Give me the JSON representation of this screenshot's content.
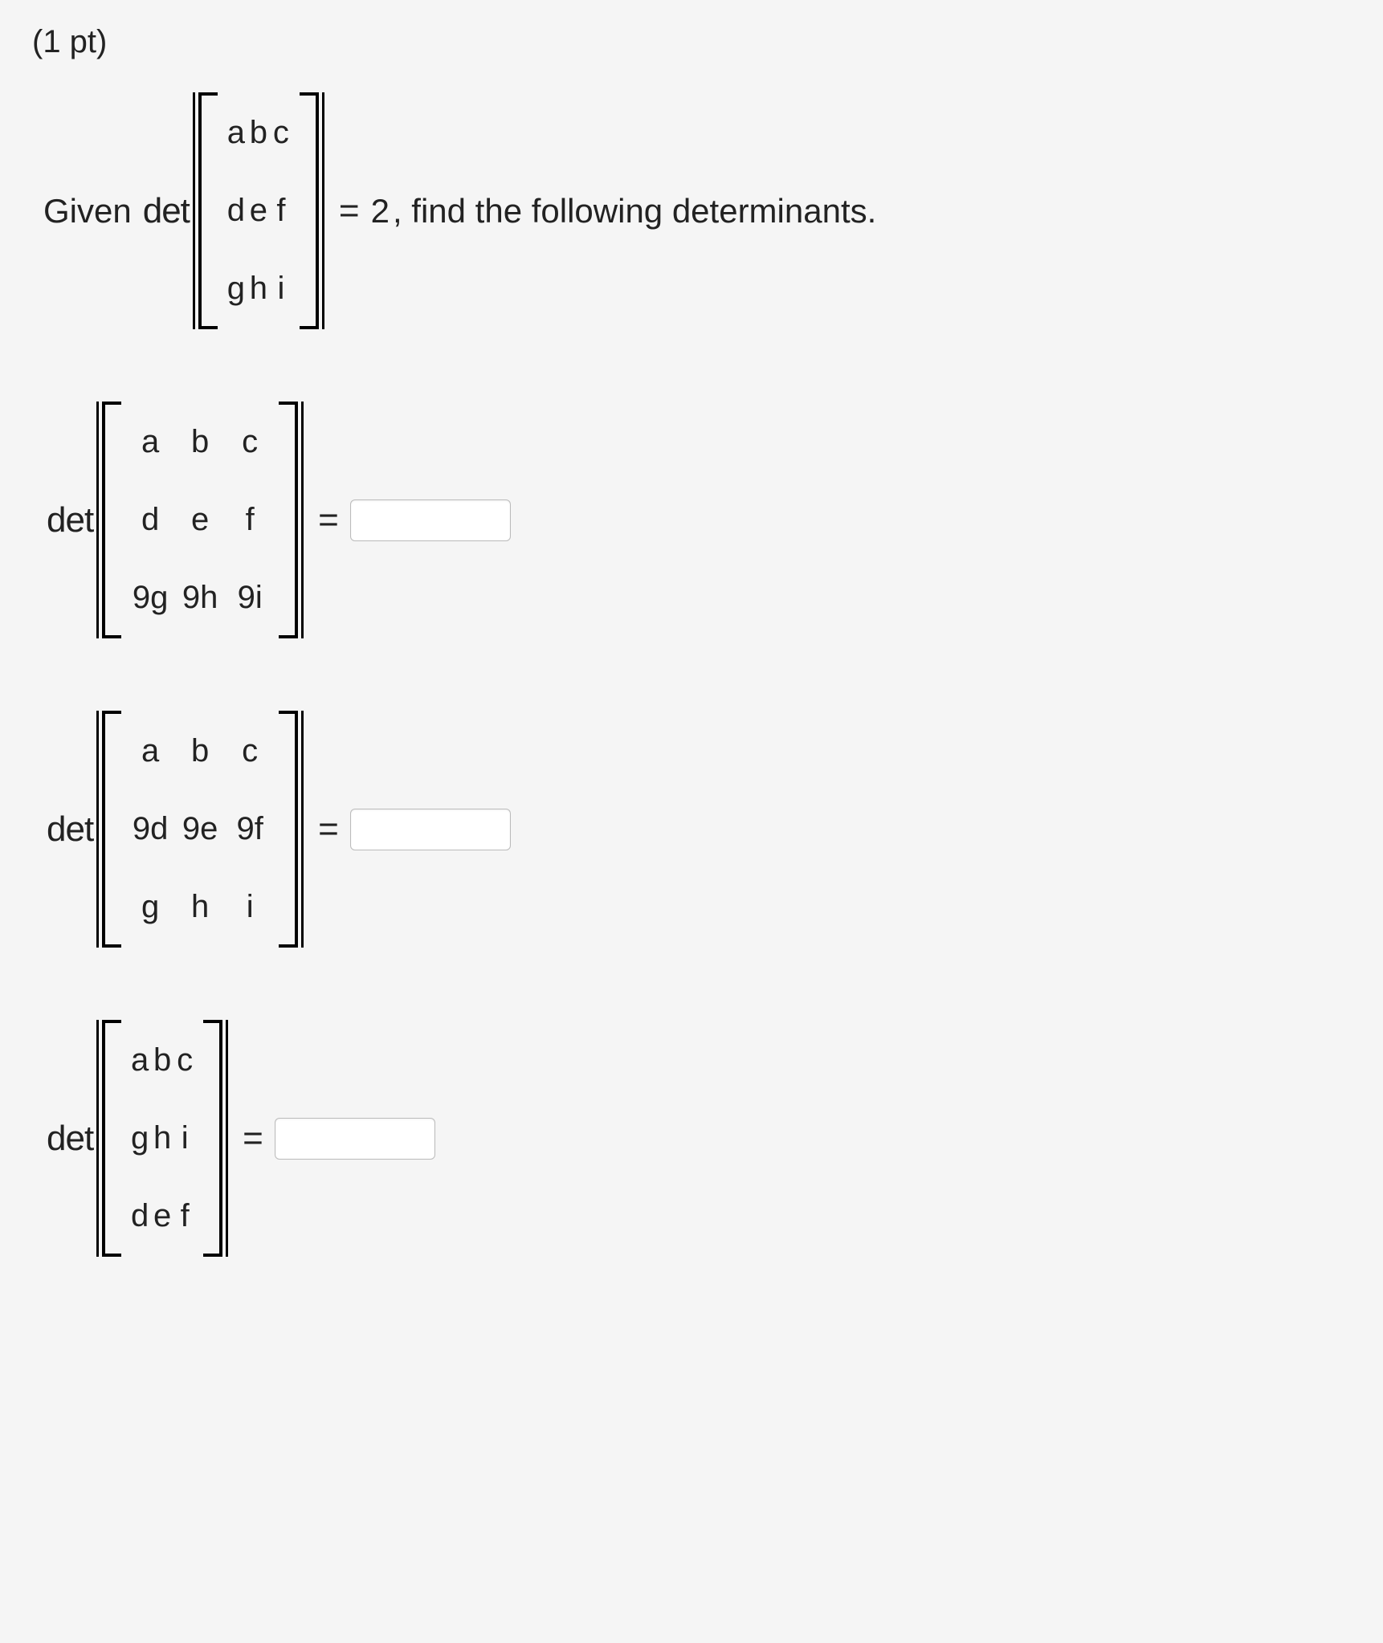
{
  "points_label": "(1 pt)",
  "given_prefix": "Given",
  "det_label": "det",
  "equals": "=",
  "given_value": "2",
  "given_suffix": ", find the following determinants.",
  "given_matrix": [
    [
      "a",
      "b",
      "c"
    ],
    [
      "d",
      "e",
      "f"
    ],
    [
      "g",
      "h",
      "i"
    ]
  ],
  "problems": [
    {
      "matrix": [
        [
          "a",
          "b",
          "c"
        ],
        [
          "d",
          "e",
          "f"
        ],
        [
          "9g",
          "9h",
          "9i"
        ]
      ],
      "style": "wide",
      "answer": ""
    },
    {
      "matrix": [
        [
          "a",
          "b",
          "c"
        ],
        [
          "9d",
          "9e",
          "9f"
        ],
        [
          "g",
          "h",
          "i"
        ]
      ],
      "style": "wide",
      "answer": ""
    },
    {
      "matrix": [
        [
          "a",
          "b",
          "c"
        ],
        [
          "g",
          "h",
          "i"
        ],
        [
          "d",
          "e",
          "f"
        ]
      ],
      "style": "tight",
      "answer": ""
    }
  ]
}
